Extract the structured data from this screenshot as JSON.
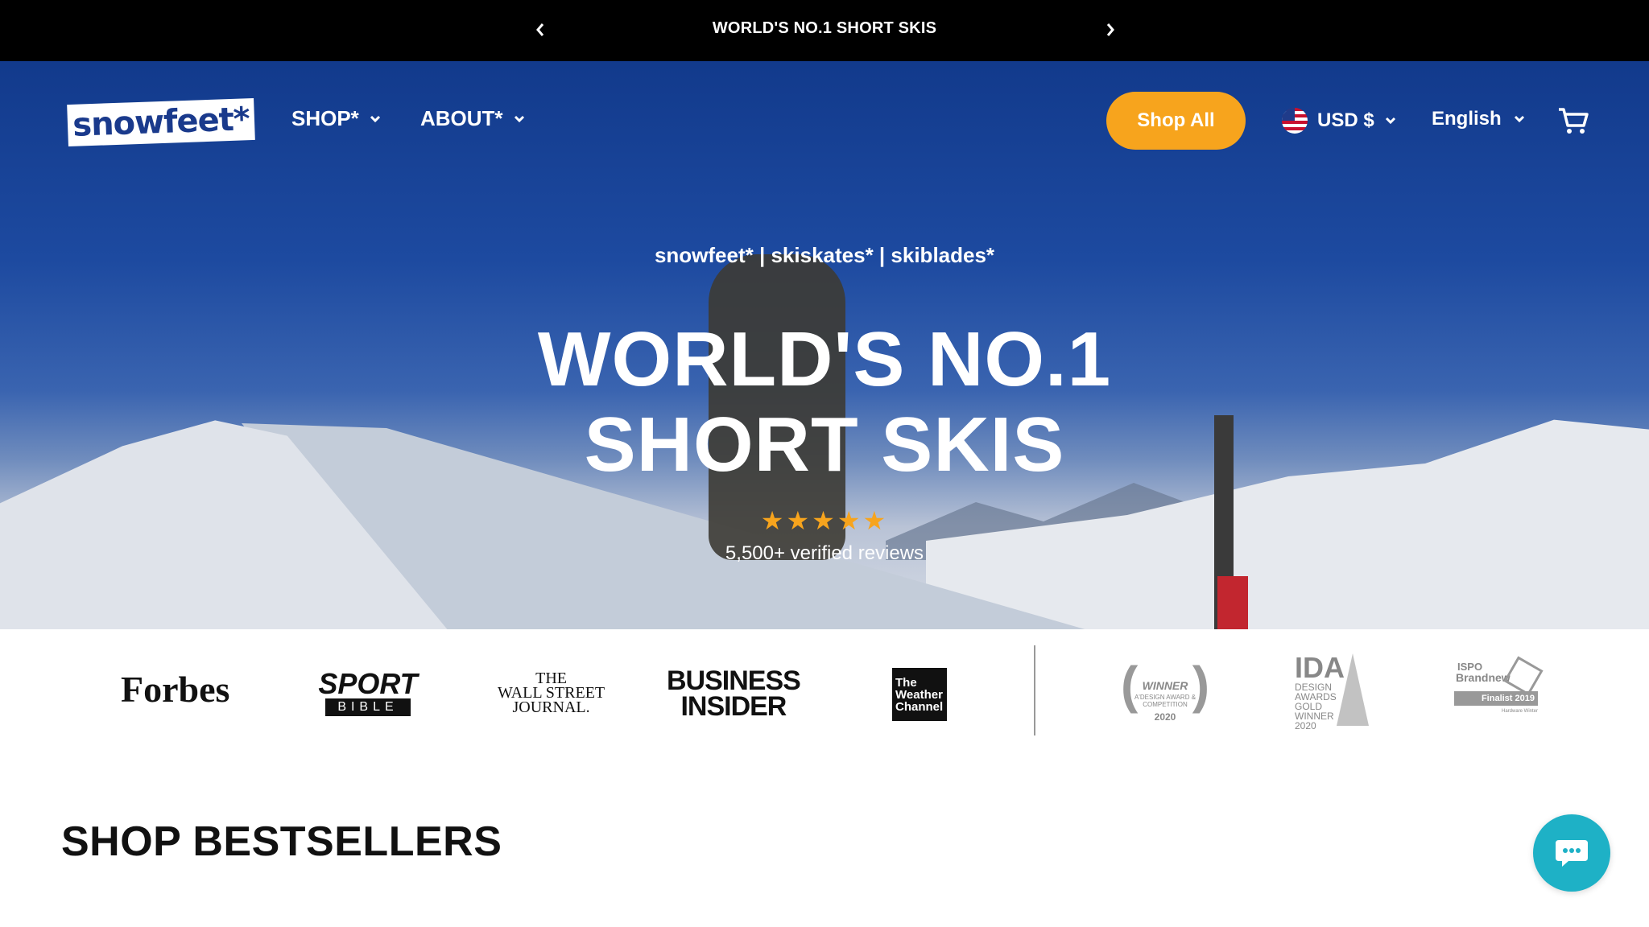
{
  "announcement": {
    "text": "WORLD'S NO.1 SHORT SKIS",
    "prev_icon": "chevron-left-icon",
    "next_icon": "chevron-right-icon"
  },
  "header": {
    "logo_text": "snowfeet*",
    "nav": [
      {
        "label": "SHOP*",
        "icon": "chevron-down-icon"
      },
      {
        "label": "ABOUT*",
        "icon": "chevron-down-icon"
      }
    ],
    "shop_all_label": "Shop All",
    "currency": {
      "label": "USD $",
      "flag": "us-flag-icon"
    },
    "language": {
      "label": "English"
    },
    "cart_icon": "cart-icon"
  },
  "hero": {
    "subtitle": "snowfeet* | skiskates* | skiblades*",
    "title_line1": "WORLD'S NO.1",
    "title_line2": "SHORT SKIS",
    "stars": "★★★★★",
    "rating_stars": 5,
    "reviews": "5,500+ verified reviews"
  },
  "press": {
    "forbes": "Forbes",
    "sport_bible_1": "SPORT",
    "sport_bible_2": "BIBLE",
    "wsj_1": "THE",
    "wsj_2": "WALL STREET",
    "wsj_3": "JOURNAL.",
    "bi_1": "BUSINESS",
    "bi_2": "INSIDER",
    "wc_1": "The",
    "wc_2": "Weather",
    "wc_3": "Channel",
    "award1_title": "WINNER",
    "award1_sub": "A'DESIGN AWARD & COMPETITION",
    "award1_year": "2020",
    "award2_title": "IDA",
    "award2_lines": [
      "DESIGN",
      "AWARDS",
      "GOLD",
      "WINNER",
      "2020"
    ],
    "award3_title": "ISPO",
    "award3_sub": "Brandnew",
    "award3_bar": "Finalist 2019",
    "award3_foot": "Hardware Winter"
  },
  "bestsellers": {
    "title": "SHOP BESTSELLERS"
  },
  "chat": {
    "icon": "chat-icon"
  },
  "colors": {
    "accent": "#f7a41d",
    "chat": "#1eb1c6",
    "logo_blue": "#1a3a8c"
  }
}
